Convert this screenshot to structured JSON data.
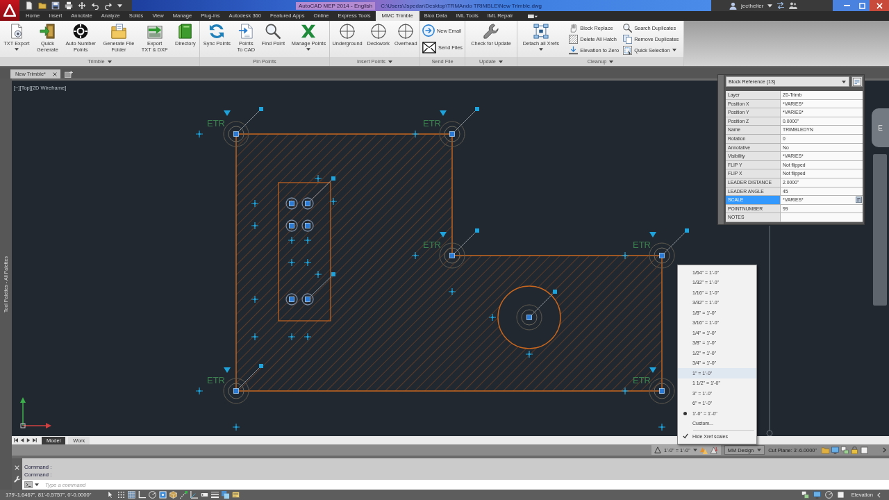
{
  "title_bar": {
    "app_title": "AutoCAD MEP 2014 - English",
    "file_path": "C:\\Users\\Jspedar\\Desktop\\TRMAndo TRIMBLE\\New Trimble.dwg",
    "user_name": "jecthelter"
  },
  "ribbon_tabs": [
    {
      "label": "Home",
      "selected": false
    },
    {
      "label": "Insert",
      "selected": false
    },
    {
      "label": "Annotate",
      "selected": false
    },
    {
      "label": "Analyze",
      "selected": false
    },
    {
      "label": "Solids",
      "selected": false
    },
    {
      "label": "View",
      "selected": false
    },
    {
      "label": "Manage",
      "selected": false
    },
    {
      "label": "Plug-ins",
      "selected": false
    },
    {
      "label": "Autodesk 360",
      "selected": false
    },
    {
      "label": "Featured Apps",
      "selected": false
    },
    {
      "label": "Online",
      "selected": false
    },
    {
      "label": "Express Tools",
      "selected": false
    },
    {
      "label": "MMC Trimble",
      "selected": true
    },
    {
      "label": "Blox Data",
      "selected": false
    },
    {
      "label": "IML Tools",
      "selected": false
    },
    {
      "label": "IML Repair",
      "selected": false
    }
  ],
  "ribbon_groups": [
    {
      "title": "Trimble",
      "menu": true,
      "buttons": [
        {
          "label": "TXT Export",
          "kind": "large",
          "dropdown": true
        },
        {
          "label": "Quick\nGenerate",
          "kind": "large",
          "dropdown": false
        },
        {
          "label": "Auto Number\nPoints",
          "kind": "large",
          "dropdown": false
        },
        {
          "label": "Generate File\nFolder",
          "kind": "large",
          "dropdown": false
        },
        {
          "label": "Export\nTXT & DXF",
          "kind": "large",
          "dropdown": false
        },
        {
          "label": "Directory",
          "kind": "large",
          "dropdown": false
        }
      ]
    },
    {
      "title": "Pin Points",
      "menu": false,
      "buttons": [
        {
          "label": "Sync Points",
          "kind": "large",
          "dropdown": false
        },
        {
          "label": "Points\nTo CAD",
          "kind": "large",
          "dropdown": false
        },
        {
          "label": "Find Point",
          "kind": "large",
          "dropdown": false
        },
        {
          "label": "Manage Points",
          "kind": "large",
          "dropdown": true
        }
      ]
    },
    {
      "title": "Insert Points",
      "menu": true,
      "buttons": [
        {
          "label": "Underground",
          "kind": "large",
          "dropdown": false
        },
        {
          "label": "Deckwork",
          "kind": "large",
          "dropdown": false
        },
        {
          "label": "Overhead",
          "kind": "large",
          "dropdown": false
        }
      ]
    },
    {
      "title": "Send File",
      "menu": false,
      "buttons": [
        {
          "label": "New Email",
          "kind": "small",
          "dropdown": false
        },
        {
          "label": "Send Files",
          "kind": "small",
          "dropdown": false
        }
      ]
    },
    {
      "title": "Update",
      "menu": true,
      "buttons": [
        {
          "label": "Check for Update",
          "kind": "large",
          "dropdown": false
        }
      ]
    },
    {
      "title": "Cleanup",
      "menu": true,
      "buttons": [
        {
          "label": "Detach all Xrefs",
          "kind": "large",
          "dropdown": true
        },
        {
          "label": "Block Replace",
          "kind": "small",
          "dropdown": false
        },
        {
          "label": "Delete All Hatch",
          "kind": "small",
          "dropdown": false
        },
        {
          "label": "Elevation to Zero",
          "kind": "small",
          "dropdown": false
        },
        {
          "label": "Search Duplicates",
          "kind": "small",
          "dropdown": false
        },
        {
          "label": "Remove Duplicates",
          "kind": "small",
          "dropdown": false
        },
        {
          "label": "Quick Selection",
          "kind": "small",
          "dropdown": true
        }
      ]
    }
  ],
  "file_tabs": [
    {
      "label": "New Trimble*",
      "selected": true
    }
  ],
  "tool_palettes": {
    "title": "Tool Palettes - All Palettes"
  },
  "viewport": {
    "label": "[−][Top][2D Wireframe]",
    "viewcube_face": "E",
    "point_labels": [
      "ETR",
      "ETR",
      "ETR",
      "ETR",
      "ETR",
      "ETR"
    ]
  },
  "properties": {
    "selection": "Block Reference (13)",
    "rows": [
      {
        "name": "Layer",
        "value": "Z0-Trimb",
        "selected": false
      },
      {
        "name": "Position X",
        "value": "*VARIES*",
        "selected": false
      },
      {
        "name": "Position Y",
        "value": "*VARIES*",
        "selected": false
      },
      {
        "name": "Position Z",
        "value": "0.0000\"",
        "selected": false
      },
      {
        "name": "Name",
        "value": "TRIMBLEDYN",
        "selected": false
      },
      {
        "name": "Rotation",
        "value": "0",
        "selected": false
      },
      {
        "name": "Annotative",
        "value": "No",
        "selected": false
      },
      {
        "name": "Visibility",
        "value": "*VARIES*",
        "selected": false
      },
      {
        "name": "FLIP Y",
        "value": "Not flipped",
        "selected": false
      },
      {
        "name": "FLIP X",
        "value": "Not flipped",
        "selected": false
      },
      {
        "name": "LEADER DISTANCE",
        "value": "2.0000\"",
        "selected": false
      },
      {
        "name": "LEADER ANGLE",
        "value": "45",
        "selected": false
      },
      {
        "name": "SCALE",
        "value": "*VARIES*",
        "selected": true
      },
      {
        "name": "POINTNUMBER",
        "value": "99",
        "selected": false
      },
      {
        "name": "NOTES",
        "selected": false
      }
    ]
  },
  "scale_menu": {
    "items": [
      {
        "label": "1/64\" = 1'-0\"",
        "selected": false,
        "highlighted": false
      },
      {
        "label": "1/32\" = 1'-0\"",
        "selected": false,
        "highlighted": false
      },
      {
        "label": "1/16\" = 1'-0\"",
        "selected": false,
        "highlighted": false
      },
      {
        "label": "3/32\" = 1'-0\"",
        "selected": false,
        "highlighted": false
      },
      {
        "label": "1/8\" = 1'-0\"",
        "selected": false,
        "highlighted": false
      },
      {
        "label": "3/16\" = 1'-0\"",
        "selected": false,
        "highlighted": false
      },
      {
        "label": "1/4\" = 1'-0\"",
        "selected": false,
        "highlighted": false
      },
      {
        "label": "3/8\" = 1'-0\"",
        "selected": false,
        "highlighted": false
      },
      {
        "label": "1/2\" = 1'-0\"",
        "selected": false,
        "highlighted": false
      },
      {
        "label": "3/4\" = 1'-0\"",
        "selected": false,
        "highlighted": false
      },
      {
        "label": "1\" = 1'-0\"",
        "selected": false,
        "highlighted": true
      },
      {
        "label": "1 1/2\" = 1'-0\"",
        "selected": false,
        "highlighted": false
      },
      {
        "label": "3\" = 1'-0\"",
        "selected": false,
        "highlighted": false
      },
      {
        "label": "6\" = 1'-0\"",
        "selected": false,
        "highlighted": false
      },
      {
        "label": "1'-0\" = 1'-0\"",
        "selected": true,
        "highlighted": false
      },
      {
        "label": "Custom...",
        "selected": false,
        "highlighted": false
      }
    ],
    "options": [
      {
        "label": "Hide Xref scales",
        "checked": true
      }
    ]
  },
  "layout_tabs": [
    {
      "label": "Model",
      "selected": true
    },
    {
      "label": "Work",
      "selected": false
    }
  ],
  "drawing_status": {
    "annotation_scale": "1'-0\" = 1'-0\"",
    "display_configuration": "MM Design",
    "cut_plane": "Cut Plane: 3'-6.0000\""
  },
  "command_line": {
    "history": [
      "Command :",
      "Command :"
    ],
    "placeholder": "Type a command"
  },
  "status_bar": {
    "coordinates": "179'-1.6467\", 81'-0.5757\", 0'-0.0000\"",
    "elevation": "Elevation"
  }
}
